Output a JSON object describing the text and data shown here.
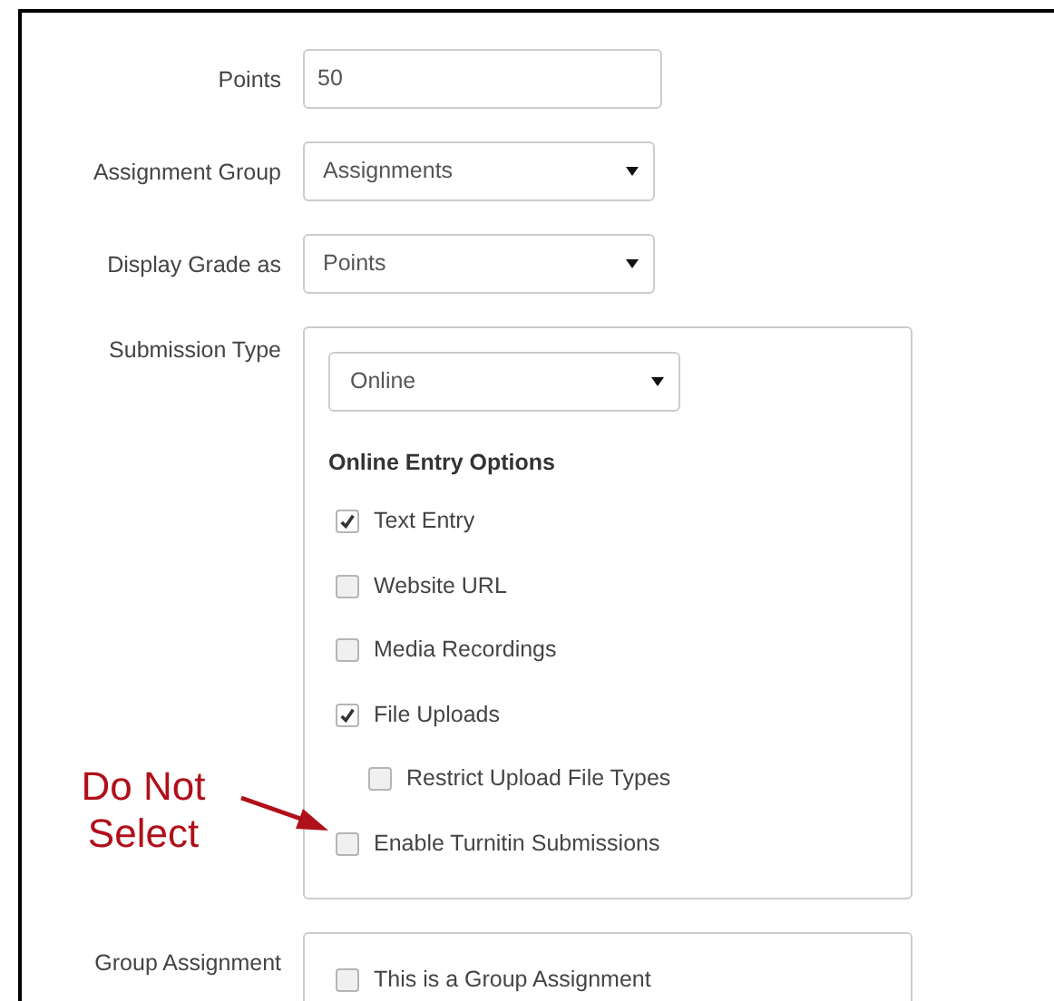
{
  "fields": [
    {
      "label": "Points",
      "kind": "input",
      "value": "50"
    },
    {
      "label": "Assignment Group",
      "kind": "select",
      "value": "Assignments"
    },
    {
      "label": "Display Grade as",
      "kind": "select",
      "value": "Points"
    }
  ],
  "submission_type": {
    "label": "Submission Type",
    "value": "Online",
    "heading": "Online Entry Options",
    "options": [
      {
        "label": "Text Entry",
        "checked": true
      },
      {
        "label": "Website URL",
        "checked": false
      },
      {
        "label": "Media Recordings",
        "checked": false
      },
      {
        "label": "File Uploads",
        "checked": true,
        "children": [
          {
            "label": "Restrict Upload File Types",
            "checked": false
          }
        ]
      },
      {
        "label": "Enable Turnitin Submissions",
        "checked": false
      }
    ]
  },
  "annotation": {
    "text": "Do Not Select"
  },
  "group_assignment": {
    "label": "Group Assignment",
    "options": [
      {
        "label": "This is a Group Assignment",
        "checked": false
      }
    ]
  }
}
